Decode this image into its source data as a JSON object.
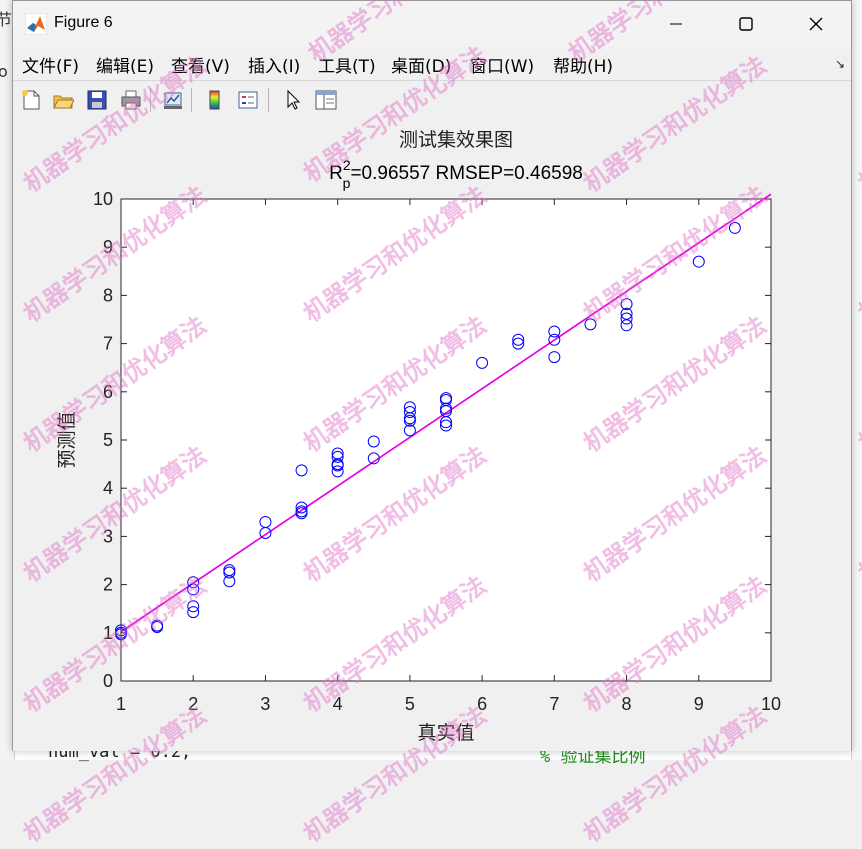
{
  "background": {
    "code_line": "num_val = 0.2;",
    "comment": "% 验证集比例",
    "left_glyph_1": "节",
    "left_glyph_2": "o"
  },
  "window": {
    "title": "Figure 6",
    "menu": [
      "文件(F)",
      "编辑(E)",
      "查看(V)",
      "插入(I)",
      "工具(T)",
      "桌面(D)",
      "窗口(W)",
      "帮助(H)"
    ],
    "toolbar_icons": [
      "new-figure-icon",
      "open-file-icon",
      "save-icon",
      "print-icon",
      "link-plot-icon",
      "colorbar-icon",
      "legend-icon",
      "pointer-icon",
      "property-editor-icon"
    ]
  },
  "watermark": "机器学习和优化算法",
  "chart_data": {
    "type": "scatter",
    "title": "测试集效果图",
    "subtitle_prefix": "R",
    "subtitle_sup": "2",
    "subtitle_sub": "p",
    "subtitle_rest": "=0.96557  RMSEP=0.46598",
    "xlabel": "真实值",
    "ylabel": "预测值",
    "xlim": [
      1,
      10
    ],
    "ylim": [
      0,
      10
    ],
    "xticks": [
      1,
      2,
      3,
      4,
      5,
      6,
      7,
      8,
      9,
      10
    ],
    "yticks": [
      0,
      1,
      2,
      3,
      4,
      5,
      6,
      7,
      8,
      9,
      10
    ],
    "marker_color": "#0000ff",
    "line_color": "#e600e6",
    "fit_line": {
      "x": [
        1,
        10
      ],
      "y": [
        1.02,
        10.1
      ]
    },
    "points": [
      [
        1,
        1.05
      ],
      [
        1,
        1.0
      ],
      [
        1,
        0.97
      ],
      [
        1.5,
        1.15
      ],
      [
        1.5,
        1.12
      ],
      [
        2,
        2.05
      ],
      [
        2,
        1.9
      ],
      [
        2,
        1.55
      ],
      [
        2,
        1.43
      ],
      [
        2.5,
        2.3
      ],
      [
        2.5,
        2.25
      ],
      [
        2.5,
        2.07
      ],
      [
        3,
        3.3
      ],
      [
        3,
        3.07
      ],
      [
        3.5,
        4.37
      ],
      [
        3.5,
        3.6
      ],
      [
        3.5,
        3.52
      ],
      [
        3.5,
        3.48
      ],
      [
        4,
        4.72
      ],
      [
        4,
        4.65
      ],
      [
        4,
        4.5
      ],
      [
        4,
        4.47
      ],
      [
        4,
        4.35
      ],
      [
        4.5,
        4.97
      ],
      [
        4.5,
        4.62
      ],
      [
        5,
        5.68
      ],
      [
        5,
        5.58
      ],
      [
        5,
        5.45
      ],
      [
        5,
        5.4
      ],
      [
        5,
        5.2
      ],
      [
        5.5,
        5.87
      ],
      [
        5.5,
        5.83
      ],
      [
        5.5,
        5.65
      ],
      [
        5.5,
        5.6
      ],
      [
        5.5,
        5.37
      ],
      [
        5.5,
        5.3
      ],
      [
        6,
        6.6
      ],
      [
        6.5,
        7.08
      ],
      [
        6.5,
        7.0
      ],
      [
        7,
        7.25
      ],
      [
        7,
        7.08
      ],
      [
        7,
        6.72
      ],
      [
        7.5,
        7.4
      ],
      [
        8,
        7.82
      ],
      [
        8,
        7.62
      ],
      [
        8,
        7.52
      ],
      [
        8,
        7.38
      ],
      [
        9,
        8.7
      ],
      [
        9.5,
        9.4
      ]
    ]
  }
}
